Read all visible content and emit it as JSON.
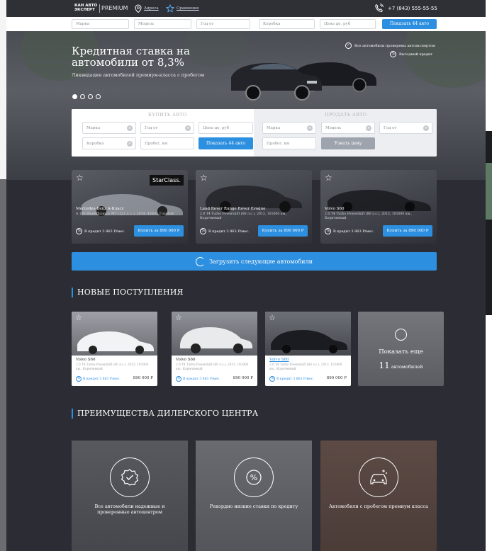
{
  "header": {
    "logo_line1": "КАН АВТО",
    "logo_line2": "ЭКСПЕРТ",
    "logo_premium": "PREMIUM",
    "address_link": "Адреса",
    "compare_link": "Сравнение",
    "phone": "+7 (843) 555-55-55"
  },
  "quick_filter": {
    "fields": [
      "Марка",
      "Модель",
      "Год от",
      "Коробка",
      "Цена до, руб"
    ],
    "button": "Показать 44 авто"
  },
  "hero": {
    "title": "Кредитная ставка на автомобили от 8,3%",
    "subtitle": "Ликвидация автомобилей премиум-класса с пробегом",
    "badge1": "Все автомобили проверены автоэкспертом",
    "badge2": "Выгодный кредит",
    "slides": 4,
    "active_slide": 1
  },
  "search_panel": {
    "buy_title": "КУПИТЬ АВТО",
    "sell_title": "ПРОДАТЬ АВТО",
    "buy_fields": {
      "make": "Марка",
      "year": "Год от",
      "price": "Цена до, руб",
      "gearbox": "Коробка",
      "mileage": "Пробег, км"
    },
    "buy_button": "Показать 44 авто",
    "sell_fields": {
      "make": "Марка",
      "model": "Модель",
      "year": "Год от",
      "mileage": "Пробег, км"
    },
    "sell_button": "Узнать цену"
  },
  "offers": [
    {
      "title": "Mercedes-Benz A-Класс",
      "desc": "A 180 BlueEfficiency MT (122 л. с.), 2014, 45000, Голубой",
      "credit": "В кредит 3 863 Р/мес.",
      "buy": "Купить за 890 000 Р",
      "brand": "StarClass."
    },
    {
      "title": "Land Rover Range Rover Evoque",
      "desc": "2.0 T4 Turbo Powershift (80 л.с.), 2013, 101000 км., Коричневый",
      "credit": "В кредит 3 863 Р/мес.",
      "buy": "Купить за 890 000 Р"
    },
    {
      "title": "Volvo S60",
      "desc": "2.0 T4 Turbo Powershift (80 л.с.), 2013, 101000 км., Коричневый",
      "credit": "В кредит 3 863 Р/мес.",
      "buy": "Купить за 890 000 Р"
    }
  ],
  "load_more": "Загрузить следующие автомобили",
  "new_section": "НОВЫЕ ПОСТУПЛЕНИЯ",
  "new_arrivals": [
    {
      "title": "Volvo S60",
      "desc": "2.0 T4 Turbo Powershift (80 л.с.), 2013, 101000 км., Коричневый",
      "credit": "В кредит 3 863 Р/мес.",
      "price": "890 000 Р"
    },
    {
      "title": "Volvo S60",
      "desc": "2.0 T4 Turbo Powershift (80 л.с.), 2013, 101000 км., Коричневый",
      "credit": "В кредит 3 863 Р/мес.",
      "price": "890 000 Р"
    },
    {
      "title": "Volvo S60",
      "desc": "2.0 T4 Turbo Powershift (80 л.с.), 2013, 101000 км., Коричневый",
      "credit": "В кредит 3 863 Р/мес.",
      "price": "890 000 Р"
    }
  ],
  "show_more": {
    "line1": "Показать еще",
    "count": "11",
    "line2": "автомобилей"
  },
  "adv_section": "ПРЕИМУЩЕСТВА ДИЛЕРСКОГО ЦЕНТРА",
  "advantages": [
    {
      "text": "Все автомобили надежные и проверенные автоцентром"
    },
    {
      "text": "Рекордно низкие ставки по кредиту"
    },
    {
      "text": "Автомобили с пробегом премиум класса"
    }
  ],
  "colors": {
    "accent": "#2d8fe0",
    "page_bg": "#2c2d34"
  }
}
